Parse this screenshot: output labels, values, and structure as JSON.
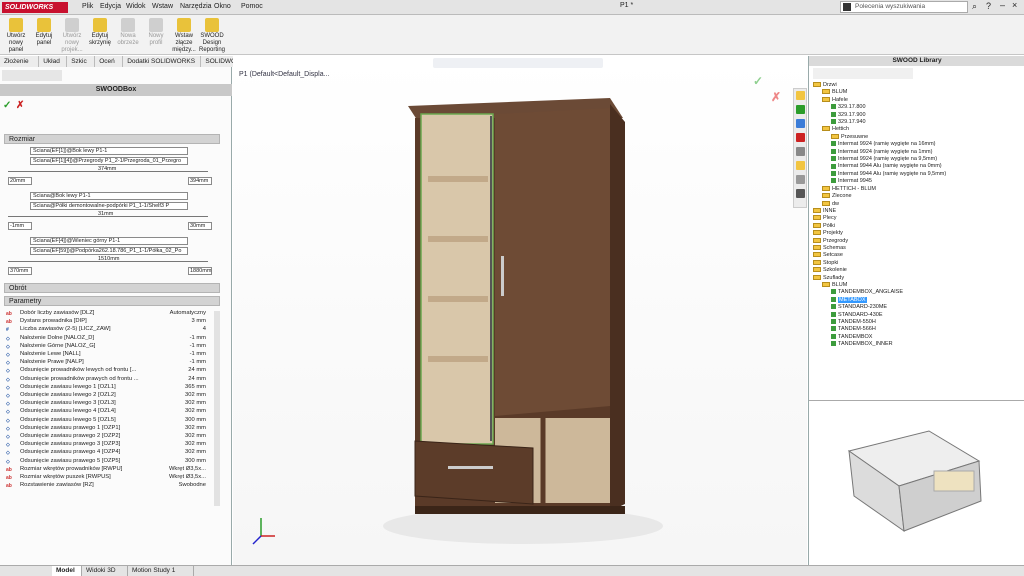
{
  "app": {
    "logo": "SOLIDWORKS",
    "doc_title": "P1 *",
    "menus": [
      "Plik",
      "Edycja",
      "Widok",
      "Wstaw",
      "Narzędzia",
      "Okno",
      "Pomoc"
    ],
    "search_placeholder": "Polecenia wyszukiwania"
  },
  "ribbon": [
    {
      "label": "Utwórz nowy panel",
      "enabled": true
    },
    {
      "label": "Edytuj panel",
      "enabled": true
    },
    {
      "label": "Utwórz nowy projek...",
      "enabled": false
    },
    {
      "label": "Edytuj skrzynię",
      "enabled": true
    },
    {
      "label": "Nowa obrzeże",
      "enabled": false
    },
    {
      "label": "Nowy profil",
      "enabled": false
    },
    {
      "label": "Wstaw złącze między...",
      "enabled": true
    },
    {
      "label": "SWOOD Design Reporting",
      "enabled": true
    }
  ],
  "tabs": [
    "Złożenie",
    "Układ",
    "Szkic",
    "Oceń",
    "Dodatki SOLIDWORKS",
    "SOLIDWORKS MBD",
    "SWOOD Design",
    "SWOOD CAM"
  ],
  "active_tab": "SWOOD Design",
  "pm": {
    "title": "SWOODBox",
    "section_rozmiar": "Rozmiar",
    "groups": [
      {
        "f1": "Ściana(EF[1])@Bok lewy P1-1",
        "f2": "Ściana(EF[1][4])@Przegrody P1_2-1/Przegroda_01_Przegro",
        "center": "374mm",
        "left": "20mm",
        "right": "394mm"
      },
      {
        "f1": "Ściana@Bok lewy P1-1",
        "f2": "Ściana@Półki demontowalne-podpórki P1_1-1/Shelf3 P",
        "center": "31mm",
        "left": "-1mm",
        "right": "30mm"
      },
      {
        "f1": "Ściana(EF[4])@Wieniec górny P1-1",
        "f2": "Ściana(EF[59])@Podpórka262.18.786_P1_1-1/Półka_02_Po",
        "center": "1510mm",
        "left": "370mm",
        "right": "1880mm"
      }
    ],
    "section_obrot": "Obrót",
    "section_params": "Parametry",
    "params": [
      {
        "icon": "ab",
        "label": "Dobór liczby zawiasów [DLZ]",
        "value": "Automatyczny"
      },
      {
        "icon": "ab",
        "label": "Dystans prowadnika [DIP]",
        "value": "3 mm"
      },
      {
        "icon": "#",
        "label": "Liczba zawiasów (2-5) [LICZ_ZAW]",
        "value": "4"
      },
      {
        "icon": "◇",
        "label": "Nałożenie Dolne [NALOZ_D]",
        "value": "-1 mm"
      },
      {
        "icon": "◇",
        "label": "Nałożenie Górne [NALOZ_G]",
        "value": "-1 mm"
      },
      {
        "icon": "◇",
        "label": "Nałożenie Lewe [NALL]",
        "value": "-1 mm"
      },
      {
        "icon": "◇",
        "label": "Nałożenie Prawe [NALP]",
        "value": "-1 mm"
      },
      {
        "icon": "◇",
        "label": "Odsunięcie prowadników lewych od frontu [...",
        "value": "24 mm"
      },
      {
        "icon": "◇",
        "label": "Odsunięcie prowadników prawych od frontu ...",
        "value": "24 mm"
      },
      {
        "icon": "◇",
        "label": "Odsunięcie zawiasu lewego 1 [OZL1]",
        "value": "365 mm"
      },
      {
        "icon": "◇",
        "label": "Odsunięcie zawiasu lewego 2 [OZL2]",
        "value": "302 mm"
      },
      {
        "icon": "◇",
        "label": "Odsunięcie zawiasu lewego 3 [OZL3]",
        "value": "302 mm"
      },
      {
        "icon": "◇",
        "label": "Odsunięcie zawiasu lewego 4 [OZL4]",
        "value": "302 mm"
      },
      {
        "icon": "◇",
        "label": "Odsunięcie zawiasu lewego 5 [OZL5]",
        "value": "300 mm"
      },
      {
        "icon": "◇",
        "label": "Odsunięcie zawiasu prawego 1 [OZP1]",
        "value": "302 mm"
      },
      {
        "icon": "◇",
        "label": "Odsunięcie zawiasu prawego 2 [OZP2]",
        "value": "302 mm"
      },
      {
        "icon": "◇",
        "label": "Odsunięcie zawiasu prawego 3 [OZP3]",
        "value": "302 mm"
      },
      {
        "icon": "◇",
        "label": "Odsunięcie zawiasu prawego 4 [OZP4]",
        "value": "302 mm"
      },
      {
        "icon": "◇",
        "label": "Odsunięcie zawiasu prawego 5 [OZP5]",
        "value": "300 mm"
      },
      {
        "icon": "ab",
        "label": "Rozmiar wkrętów prowadników [RWPU]",
        "value": "Wkręt Ø3,5x..."
      },
      {
        "icon": "ab",
        "label": "Rozmiar wkrętów puszek [RWPUS]",
        "value": "Wkręt Ø3,5x..."
      },
      {
        "icon": "ab",
        "label": "Rozstawienie zawiasów [RZ]",
        "value": "Swobodne"
      }
    ]
  },
  "viewport": {
    "tree_root": "P1 (Default<Default_Displa..."
  },
  "library": {
    "title": "SWOOD Library",
    "items": [
      {
        "d": 0,
        "t": "f",
        "text": "Drzwi"
      },
      {
        "d": 1,
        "t": "f",
        "text": "BLUM"
      },
      {
        "d": 1,
        "t": "f",
        "text": "Hafele"
      },
      {
        "d": 2,
        "t": "p",
        "text": "329.17.800"
      },
      {
        "d": 2,
        "t": "p",
        "text": "329.17.900"
      },
      {
        "d": 2,
        "t": "p",
        "text": "329.17.940"
      },
      {
        "d": 1,
        "t": "f",
        "text": "Hettich"
      },
      {
        "d": 2,
        "t": "f",
        "text": "Przesuwne"
      },
      {
        "d": 2,
        "t": "p",
        "text": "Intermat 9924 (ramię wygięte na 16mm)"
      },
      {
        "d": 2,
        "t": "p",
        "text": "Intermat 9924 (ramię wygięte na 1mm)"
      },
      {
        "d": 2,
        "t": "p",
        "text": "Intermat 9924 (ramię wygięte na 9,5mm)"
      },
      {
        "d": 2,
        "t": "p",
        "text": "Intermat 9944 Alu (ramię wygięte na 0mm)"
      },
      {
        "d": 2,
        "t": "p",
        "text": "Intermat 9944 Alu (ramię wygięte na 9,5mm)"
      },
      {
        "d": 2,
        "t": "p",
        "text": "Intermat 9945"
      },
      {
        "d": 1,
        "t": "f",
        "text": "HETTICH - BLUM"
      },
      {
        "d": 1,
        "t": "f",
        "text": "Zlecone"
      },
      {
        "d": 1,
        "t": "f",
        "text": "dw"
      },
      {
        "d": 0,
        "t": "f",
        "text": "INNE"
      },
      {
        "d": 0,
        "t": "f",
        "text": "Plecy"
      },
      {
        "d": 0,
        "t": "f",
        "text": "Półki"
      },
      {
        "d": 0,
        "t": "f",
        "text": "Projekty"
      },
      {
        "d": 0,
        "t": "f",
        "text": "Przegrody"
      },
      {
        "d": 0,
        "t": "f",
        "text": "Schemas"
      },
      {
        "d": 0,
        "t": "f",
        "text": "Setcase"
      },
      {
        "d": 0,
        "t": "f",
        "text": "Stopki"
      },
      {
        "d": 0,
        "t": "f",
        "text": "Szkolenie"
      },
      {
        "d": 0,
        "t": "f",
        "text": "Szuflady"
      },
      {
        "d": 1,
        "t": "f",
        "text": "BLUM"
      },
      {
        "d": 2,
        "t": "p",
        "text": "TANDEMBOX_ANGLAISE"
      },
      {
        "d": 2,
        "t": "p",
        "text": "METABOX",
        "selected": true
      },
      {
        "d": 2,
        "t": "p",
        "text": "STANDARD-230ME"
      },
      {
        "d": 2,
        "t": "p",
        "text": "STANDARD-430E"
      },
      {
        "d": 2,
        "t": "p",
        "text": "TANDEM-550H"
      },
      {
        "d": 2,
        "t": "p",
        "text": "TANDEM-566H"
      },
      {
        "d": 2,
        "t": "p",
        "text": "TANDEMBOX"
      },
      {
        "d": 2,
        "t": "p",
        "text": "TANDEMBOX_INNER"
      }
    ]
  },
  "bottom_tabs": [
    "Model",
    "Widoki 3D",
    "Motion Study 1"
  ],
  "active_bottom_tab": "Model"
}
